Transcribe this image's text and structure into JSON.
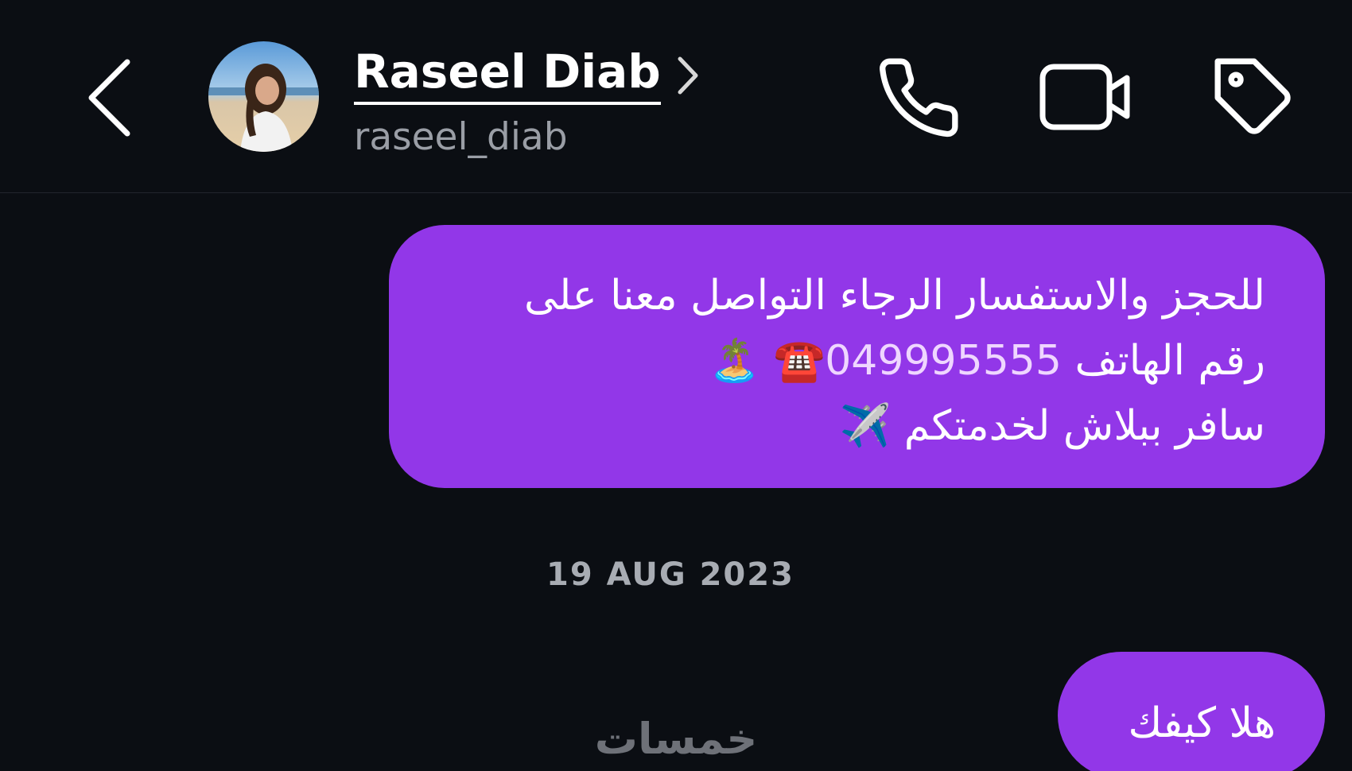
{
  "header": {
    "contact_name": "Raseel Diab",
    "contact_handle": "raseel_diab",
    "icons": [
      "back-chevron-icon",
      "chevron-right-icon",
      "phone-icon",
      "video-camera-icon",
      "tag-icon"
    ]
  },
  "messages": [
    {
      "lines": [
        "للحجز والاستفسار الرجاء التواصل معنا على",
        "رقم الهاتف"
      ],
      "phone_number": "049995555",
      "phone_emoji": "☎️",
      "island_emoji": "🏝️",
      "line3_text": "سافر ببلاش لخدمتكم",
      "plane_emoji": "✈️"
    },
    {
      "text": "هلا كيفك"
    }
  ],
  "date_divider": "19 AUG 2023",
  "watermark": "خمسات",
  "colors": {
    "background": "#0b0e13",
    "bubble": "#9237e8",
    "secondary_text": "#9a9ea6"
  }
}
